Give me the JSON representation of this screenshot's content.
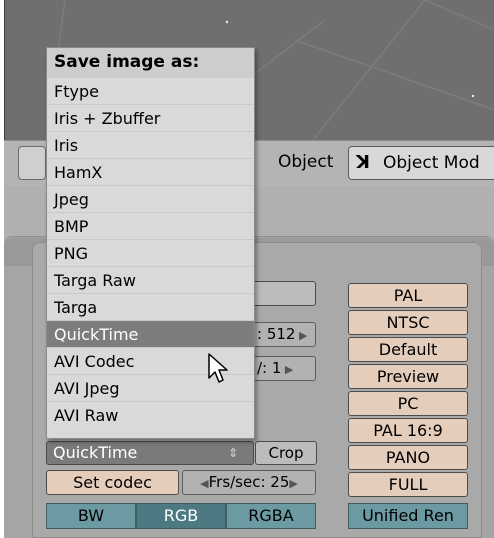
{
  "header": {
    "object_label": "Object",
    "mode_label": "Object Mod"
  },
  "menu": {
    "title": "Save image as:",
    "items": [
      "Ftype",
      "Iris + Zbuffer",
      "Iris",
      "HamX",
      "Jpeg",
      "BMP",
      "PNG",
      "Targa Raw",
      "Targa",
      "QuickTime",
      "AVI Codec",
      "AVI Jpeg",
      "AVI Raw"
    ],
    "highlighted": "QuickTime"
  },
  "format": {
    "selected": "QuickTime",
    "crop_label": "Crop",
    "set_codec_label": "Set codec",
    "frs_sec": "Frs/sec: 25",
    "size_x": ": 512",
    "size_y": "/: 1",
    "color_modes": [
      "BW",
      "RGB",
      "RGBA"
    ],
    "selected_color_mode": "RGB"
  },
  "presets": [
    "PAL",
    "NTSC",
    "Default",
    "Preview",
    "PC",
    "PAL 16:9",
    "PANO",
    "FULL",
    "Unified Ren"
  ]
}
